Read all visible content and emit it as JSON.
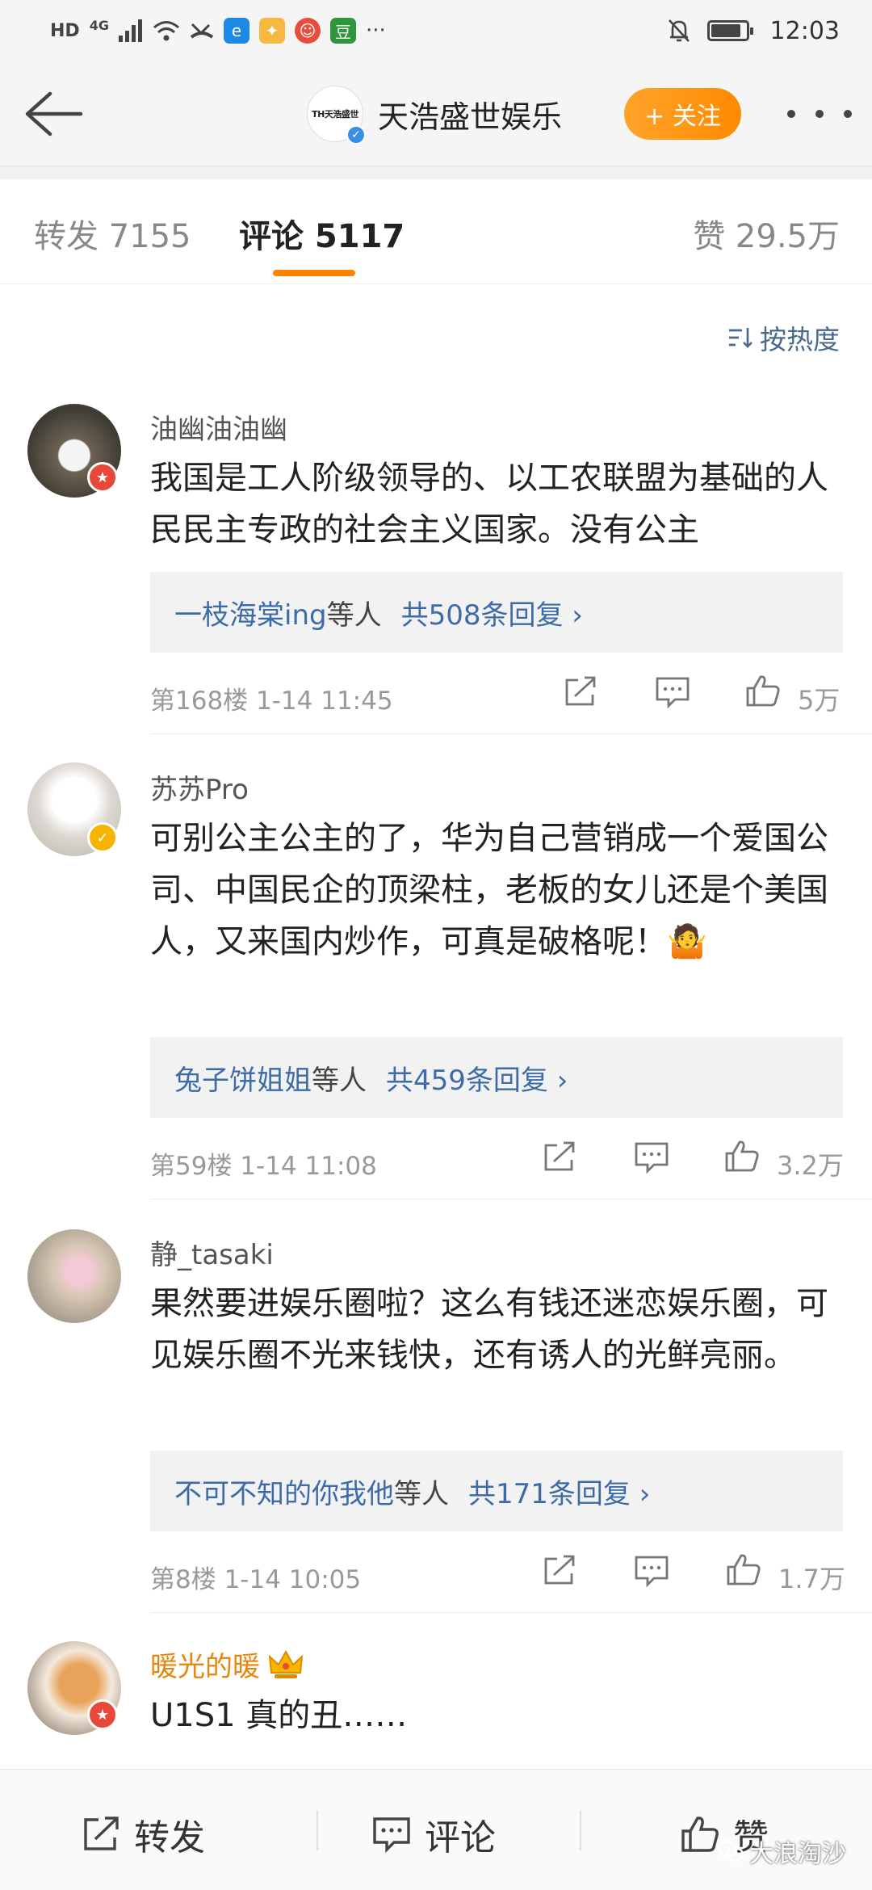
{
  "status_bar": {
    "hd": "HD",
    "net": "4G",
    "apps": [
      "e",
      "豆"
    ],
    "more": "···",
    "time": "12:03"
  },
  "header": {
    "account_name": "天浩盛世娱乐",
    "avatar_text": "TH天浩盛世",
    "follow_label": "+ 关注"
  },
  "tabs": [
    {
      "label": "转发 7155"
    },
    {
      "label": "评论 5117"
    },
    {
      "label": "赞 29.5万"
    }
  ],
  "sort_label": "按热度",
  "comments": [
    {
      "username": "油幽油油幽",
      "text": "我国是工人阶级领导的、以工农联盟为基础的人民民主专政的社会主义国家。没有公主",
      "reply_user": "一枝海棠ing",
      "reply_suffix": "等人",
      "reply_count": "共508条回复 ›",
      "meta": "第168楼  1-14 11:45",
      "likes": "5万"
    },
    {
      "username": "苏苏Pro",
      "text": "可别公主公主的了，华为自己营销成一个爱国公司、中国民企的顶梁柱，老板的女儿还是个美国人，又来国内炒作，可真是破格呢！🤷",
      "reply_user": "兔子饼姐姐",
      "reply_suffix": "等人",
      "reply_count": "共459条回复 ›",
      "meta": "第59楼  1-14 11:08",
      "likes": "3.2万"
    },
    {
      "username": "静_tasaki",
      "text": "果然要进娱乐圈啦？这么有钱还迷恋娱乐圈，可见娱乐圈不光来钱快，还有诱人的光鲜亮丽。",
      "reply_user": "不可不知的你我他",
      "reply_suffix": "等人",
      "reply_count": "共171条回复 ›",
      "meta": "第8楼  1-14 10:05",
      "likes": "1.7万"
    },
    {
      "username": "暖光的暖",
      "text": "U1S1 真的丑……"
    }
  ],
  "bottom_bar": {
    "repost": "转发",
    "comment": "评论",
    "like": "赞"
  },
  "watermark": "大浪淘沙",
  "colors": {
    "accent": "#ff8200",
    "link": "#3c6ba8",
    "header_bg": "#f5f5f5"
  }
}
